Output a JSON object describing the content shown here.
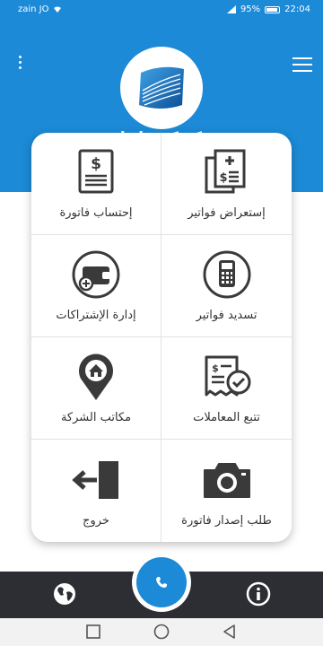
{
  "status": {
    "carrier": "zain JO",
    "battery": "95%",
    "time": "22:04"
  },
  "header": {
    "company_name": "شركة كهرباء إربد"
  },
  "tiles": [
    {
      "label": "إحتساب فاتورة",
      "icon": "bill-calculation-icon"
    },
    {
      "label": "إستعراض فواتير",
      "icon": "bills-list-icon"
    },
    {
      "label": "إدارة الإشتراكات",
      "icon": "wallet-icon"
    },
    {
      "label": "تسديد فواتير",
      "icon": "payment-terminal-icon"
    },
    {
      "label": "مكاتب الشركة",
      "icon": "location-pin-icon"
    },
    {
      "label": "تتبع المعاملات",
      "icon": "track-transactions-icon"
    },
    {
      "label": "خروج",
      "icon": "logout-icon"
    },
    {
      "label": "طلب إصدار فاتورة",
      "icon": "camera-icon"
    }
  ],
  "colors": {
    "primary": "#1c8ad6",
    "bottom_bar": "#2d2d34",
    "icon": "#3a3a3a"
  }
}
